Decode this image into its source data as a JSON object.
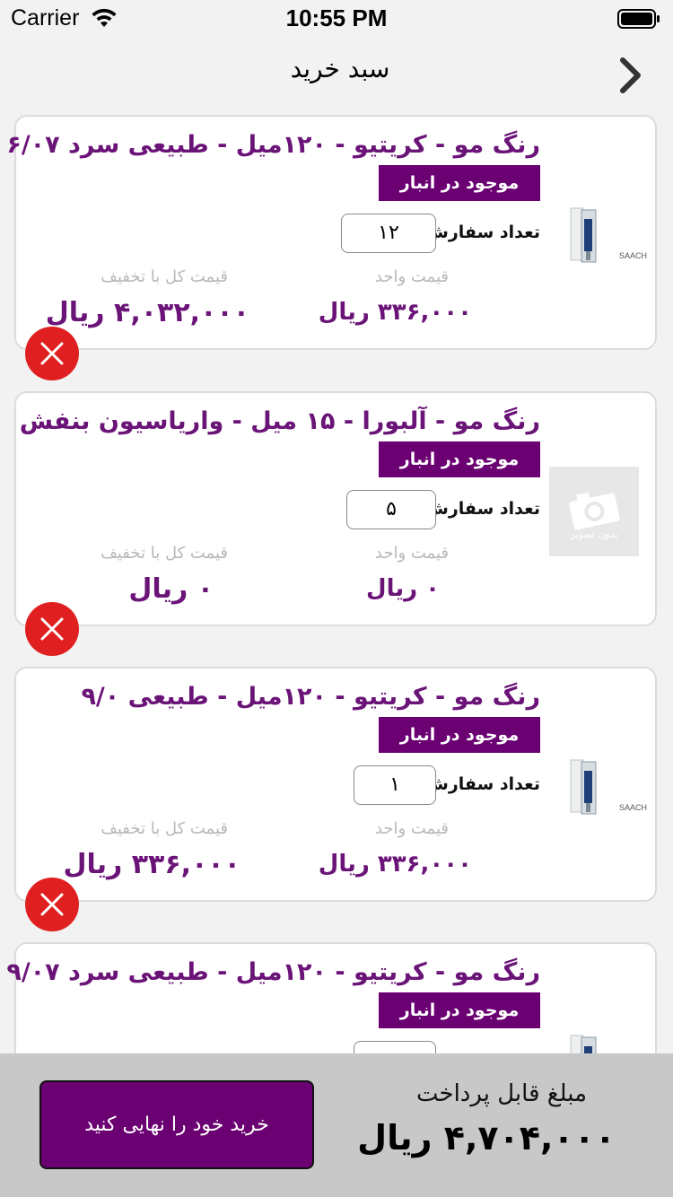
{
  "status_bar": {
    "carrier": "Carrier",
    "time": "10:55 PM"
  },
  "nav": {
    "title": "سبد خرید",
    "back_icon": "chevron-right-icon"
  },
  "labels": {
    "quantity_label": "تعداد سفارش:",
    "unit_price_caption": "قیمت واحد",
    "total_price_caption": "قیمت کل با تخفیف"
  },
  "items": [
    {
      "title": "رنگ مو - کریتیو - ۱۲۰میل - طبیعی سرد ۶/۰۷",
      "stock_status": "موجود در انبار",
      "quantity": "۱۲",
      "unit_price": "۳۳۶,۰۰۰ ریال",
      "total_price": "۴,۰۳۲,۰۰۰ ریال",
      "thumbnail_caption": "SAACH",
      "has_image": true
    },
    {
      "title": "رنگ مو - آلبورا - ۱۵ میل - واریاسیون بنفش",
      "stock_status": "موجود در انبار",
      "quantity": "۵",
      "unit_price": "۰ ریال",
      "total_price": "۰ ریال",
      "thumbnail_caption": "بدون تصویر",
      "has_image": false
    },
    {
      "title": "رنگ مو - کریتیو - ۱۲۰میل - طبیعی ۹/۰",
      "stock_status": "موجود در انبار",
      "quantity": "۱",
      "unit_price": "۳۳۶,۰۰۰ ریال",
      "total_price": "۳۳۶,۰۰۰ ریال",
      "thumbnail_caption": "SAACH",
      "has_image": true
    },
    {
      "title": "رنگ مو - کریتیو - ۱۲۰میل - طبیعی سرد ۹/۰۷",
      "stock_status": "موجود در انبار",
      "quantity": "",
      "unit_price": "",
      "total_price": "",
      "thumbnail_caption": "",
      "has_image": true
    }
  ],
  "footer": {
    "payable_label": "مبلغ قابل پرداخت",
    "payable_amount": "۴,۷۰۴,۰۰۰ ریال",
    "checkout_label": "خرید خود را نهایی کنید"
  },
  "colors": {
    "brand_purple": "#6b0072",
    "title_purple": "#6b1478",
    "delete_red": "#e02020",
    "footer_gray": "#c8c8c8"
  }
}
